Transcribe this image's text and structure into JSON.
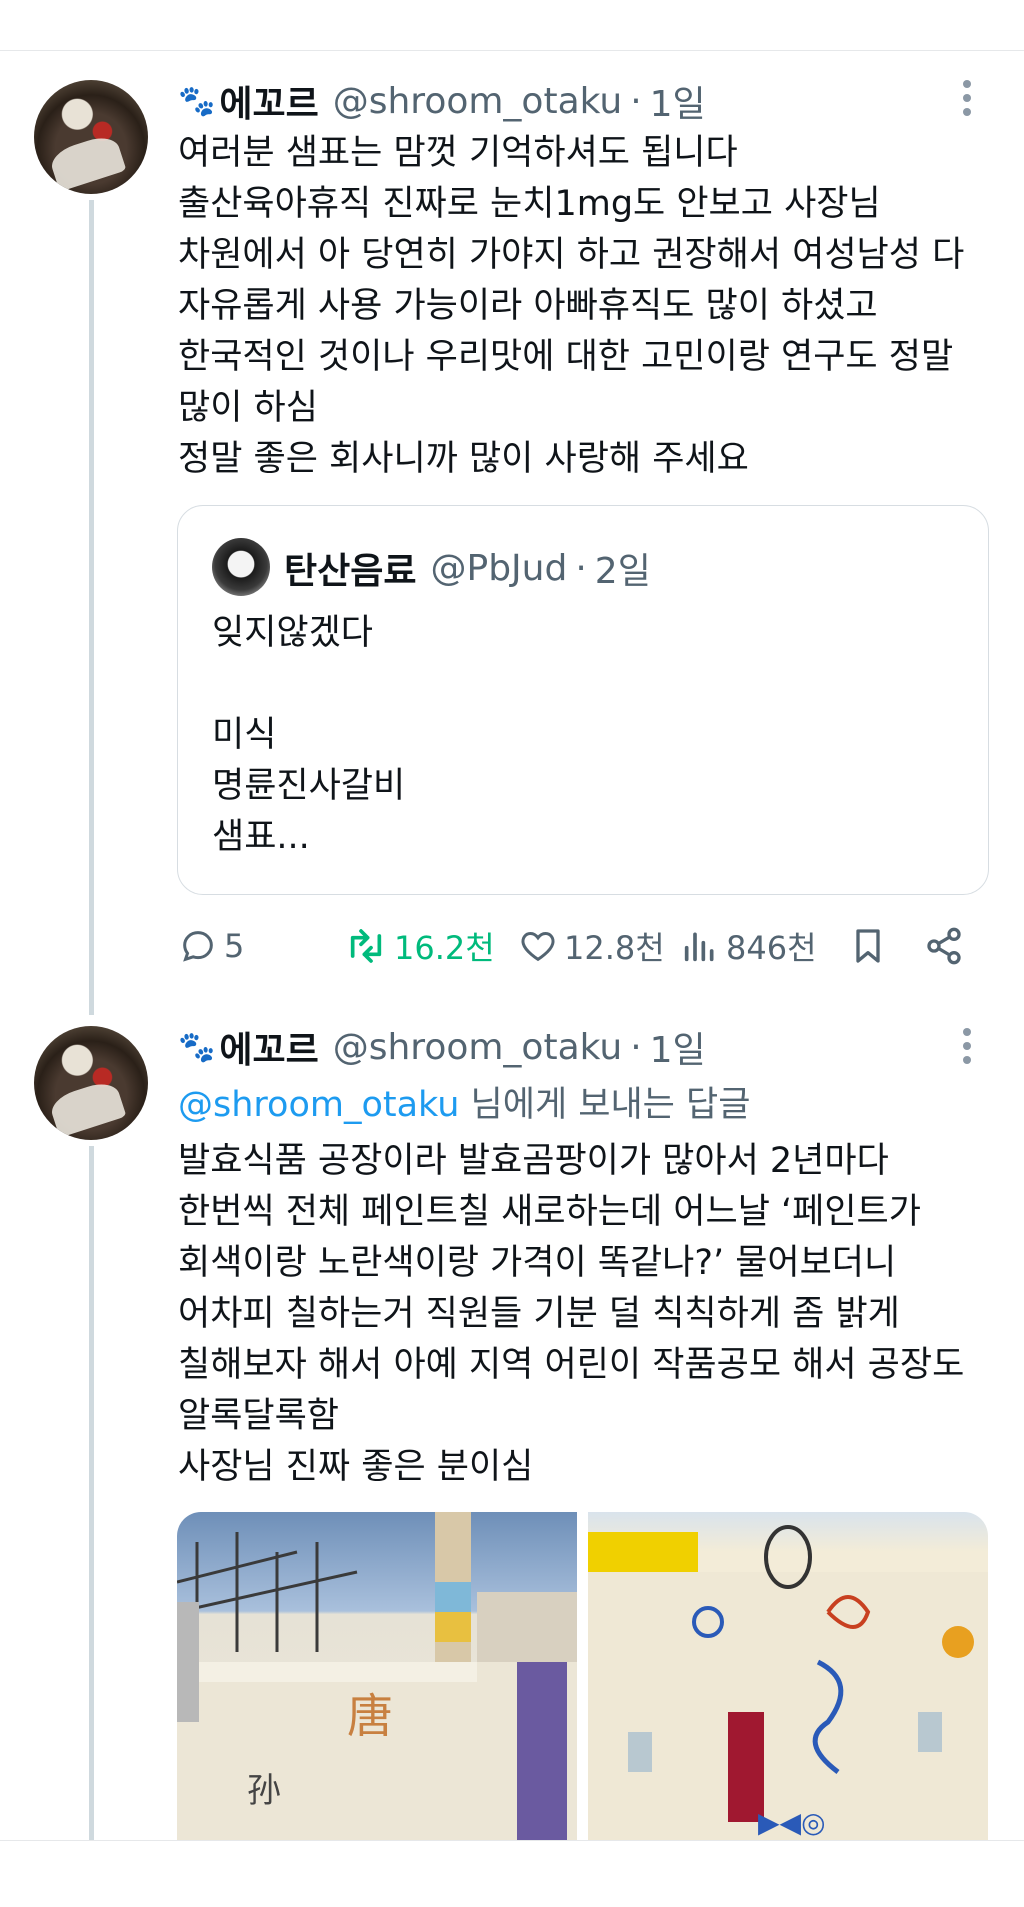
{
  "tweets": [
    {
      "author": {
        "name": "에꼬르",
        "handle": "@shroom_otaku",
        "dot": "·",
        "time": "1일",
        "badge_icon": "paw-prints-icon"
      },
      "body": "여러분 샘표는 맘껏 기억하셔도 됩니다\n출산육아휴직 진짜로 눈치1mg도 안보고 사장님\n차원에서 아 당연히 가야지 하고 권장해서 여성남성 다\n자유롭게 사용 가능이라 아빠휴직도 많이 하셨고\n한국적인 것이나 우리맛에 대한 고민이랑 연구도 정말\n많이 하심\n정말 좋은 회사니까 많이 사랑해 주세요",
      "quote": {
        "author": {
          "name": "탄산음료",
          "handle": "@PbJud",
          "dot": "·",
          "time": "2일"
        },
        "body": "잊지않겠다\n\n미식\n명륜진사갈비\n샘표..."
      },
      "actions": {
        "replies": "5",
        "retweets": "16.2천",
        "likes": "12.8천",
        "views": "846천"
      }
    },
    {
      "author": {
        "name": "에꼬르",
        "handle": "@shroom_otaku",
        "dot": "·",
        "time": "1일",
        "badge_icon": "paw-prints-icon"
      },
      "reply_to": {
        "mention": "@shroom_otaku",
        "suffix": " 님에게 보내는 답글"
      },
      "body": "발효식품 공장이라 발효곰팡이가 많아서 2년마다\n한번씩 전체 페인트칠 새로하는데 어느날 ‘페인트가\n회색이랑 노란색이랑 가격이 똑같나?’ 물어보더니\n어차피 칠하는거 직원들 기분 덜 칙칙하게 좀 밝게\n칠해보자 해서 아예 지역 어린이 작품공모 해서 공장도\n알록달록함\n사장님 진짜 좋은 분이심"
    }
  ],
  "colors": {
    "accent": "#1d9bf0",
    "retweet": "#00ba7c",
    "muted": "#536471"
  }
}
